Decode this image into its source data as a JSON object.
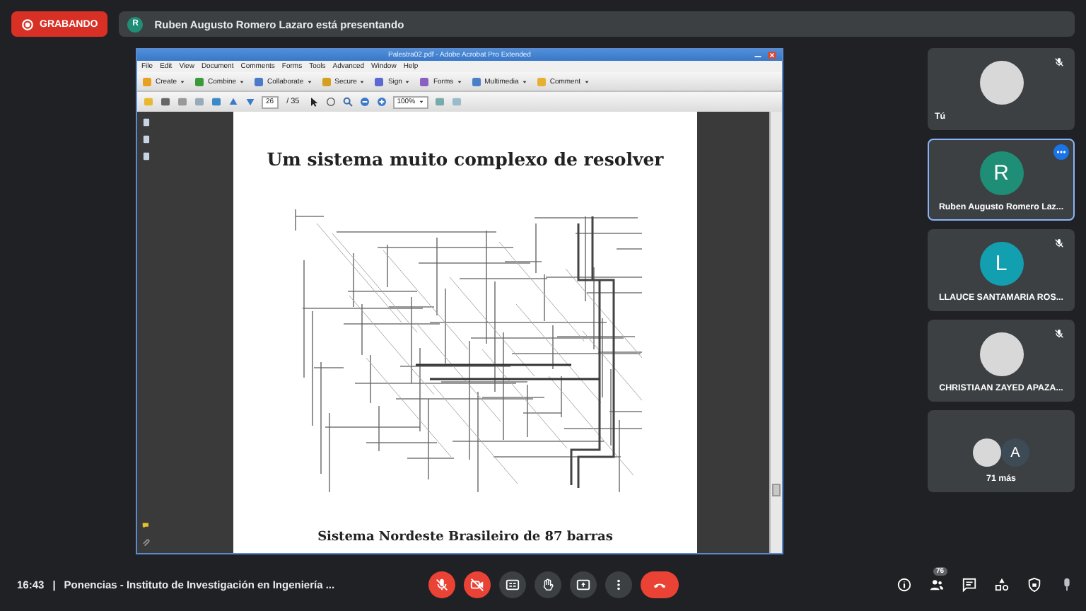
{
  "recording": {
    "label": "GRABANDO"
  },
  "presenter": {
    "avatar_letter": "R",
    "color": "#1e8e76",
    "text": "Ruben Augusto Romero Lazaro está presentando"
  },
  "shared_window": {
    "title": "Palestra02.pdf - Adobe Acrobat Pro Extended",
    "menu": [
      "File",
      "Edit",
      "View",
      "Document",
      "Comments",
      "Forms",
      "Tools",
      "Advanced",
      "Window",
      "Help"
    ],
    "toolbar": [
      "Create",
      "Combine",
      "Collaborate",
      "Secure",
      "Sign",
      "Forms",
      "Multimedia",
      "Comment"
    ],
    "page_number": "26",
    "page_total": "/ 35",
    "zoom": "100%",
    "slide": {
      "title": "Um sistema muito complexo de resolver",
      "caption": "Sistema Nordeste Brasileiro de 87 barras"
    }
  },
  "participants": [
    {
      "kind": "photo",
      "name": "Tú",
      "muted": true,
      "options_shown": false,
      "selected": false
    },
    {
      "kind": "letter",
      "letter": "R",
      "color": "#1e8e76",
      "name": "Ruben Augusto Romero Laz...",
      "muted": false,
      "options_shown": true,
      "selected": true
    },
    {
      "kind": "letter",
      "letter": "L",
      "color": "#12a0b0",
      "name": "LLAUCE SANTAMARIA ROS...",
      "muted": true,
      "options_shown": false,
      "selected": false
    },
    {
      "kind": "photo",
      "name": "CHRISTIAAN ZAYED APAZA...",
      "muted": true,
      "options_shown": false,
      "selected": false
    },
    {
      "kind": "group",
      "letter": "A",
      "color": "#3d4b57",
      "name": "71 más",
      "muted": false,
      "options_shown": false,
      "selected": false
    }
  ],
  "bottom_bar": {
    "time": "16:43",
    "separator": "|",
    "meeting_title": "Ponencias - Instituto de Investigación en Ingeniería ...",
    "controls": [
      {
        "kind": "mic",
        "off": true
      },
      {
        "kind": "camera",
        "off": true
      },
      {
        "kind": "captions",
        "off": false
      },
      {
        "kind": "hand",
        "off": false
      },
      {
        "kind": "present",
        "off": false
      },
      {
        "kind": "more",
        "off": false
      },
      {
        "kind": "hangup"
      }
    ],
    "people_count": "76"
  }
}
